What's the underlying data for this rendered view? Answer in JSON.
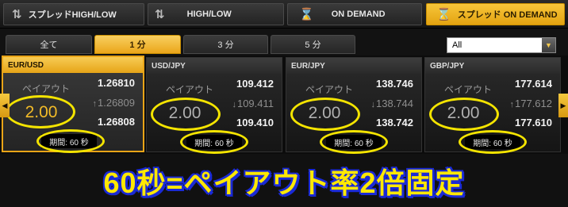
{
  "top_tabs": [
    {
      "label": "スプレッドHIGH/LOW",
      "icon": "updown-arrows-icon"
    },
    {
      "label": "HIGH/LOW",
      "icon": "updown-arrows-icon"
    },
    {
      "label": "ON DEMAND",
      "icon": "hourglass-icon"
    },
    {
      "label": "スプレッド ON DEMAND",
      "icon": "hourglass-icon",
      "active": true
    }
  ],
  "duration_tabs": [
    {
      "label": "全て"
    },
    {
      "label": "1 分",
      "active": true
    },
    {
      "label": "3 分"
    },
    {
      "label": "5 分"
    }
  ],
  "filter_select": {
    "value": "All"
  },
  "cards": [
    {
      "pair": "EUR/USD",
      "payout_label": "ペイアウト",
      "payout": "2.00",
      "high": "1.26810",
      "mid": "1.26809",
      "low": "1.26808",
      "period": "期間: 60 秒",
      "active": true
    },
    {
      "pair": "USD/JPY",
      "payout_label": "ペイアウト",
      "payout": "2.00",
      "high": "109.412",
      "mid": "109.411",
      "low": "109.410",
      "period": "期間: 60 秒"
    },
    {
      "pair": "EUR/JPY",
      "payout_label": "ペイアウト",
      "payout": "2.00",
      "high": "138.746",
      "mid": "138.744",
      "low": "138.742",
      "period": "期間: 60 秒"
    },
    {
      "pair": "GBP/JPY",
      "payout_label": "ペイアウト",
      "payout": "2.00",
      "high": "177.614",
      "mid": "177.612",
      "low": "177.610",
      "period": "期間: 60 秒"
    }
  ],
  "nav": {
    "prev": "◀",
    "next": "▶"
  },
  "caption": "60秒=ペイアウト率2倍固定",
  "colors": {
    "accent": "#e9a417",
    "highlight_ring": "#f4e400",
    "caption_text": "#ffe800",
    "caption_outline": "#1a2ad6"
  }
}
